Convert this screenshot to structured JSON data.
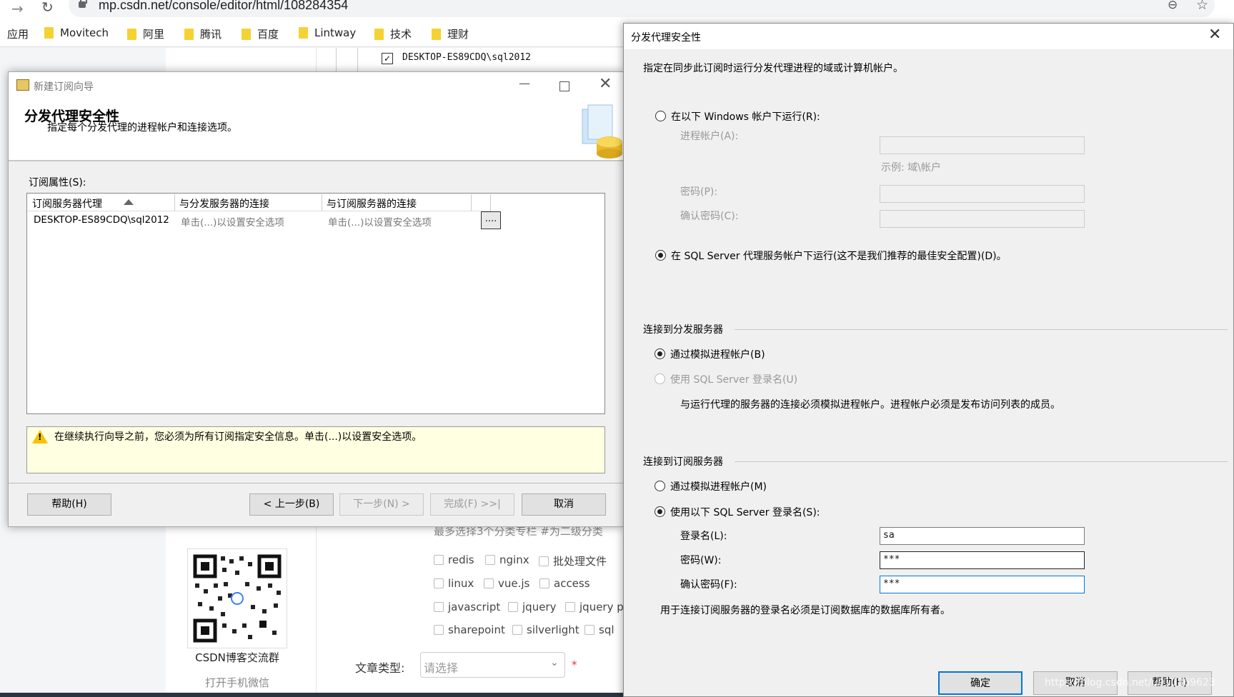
{
  "browser": {
    "url": "mp.csdn.net/console/editor/html/108284354",
    "bookmarks": [
      "应用",
      "Movitech",
      "阿里",
      "腾讯",
      "百度",
      "Lintway",
      "技术",
      "理财"
    ]
  },
  "background_page": {
    "top_row_item": "DESKTOP-ES89CDQ\\sql2012",
    "qr_caption": "CSDN博客交流群",
    "qr_subcaption": "打开手机微信",
    "tags_hint": "最多选择3个分类专栏  #为二级分类",
    "tags": [
      "redis",
      "nginx",
      "批处理文件",
      "linux",
      "vue.js",
      "access",
      "javascript",
      "jquery",
      "jquery pl",
      "sharepoint",
      "silverlight",
      "sql"
    ],
    "article_type_label": "文章类型:",
    "article_type_placeholder": "请选择",
    "required_mark": "*"
  },
  "wizard": {
    "title": "新建订阅向导",
    "heading": "分发代理安全性",
    "subheading": "指定每个分发代理的进程帐户和连接选项。",
    "props_label": "订阅属性(S):",
    "columns": [
      "订阅服务器代理",
      "与分发服务器的连接",
      "与订阅服务器的连接"
    ],
    "row": [
      "DESKTOP-ES89CDQ\\sql2012",
      "单击(...)以设置安全选项",
      "单击(...)以设置安全选项"
    ],
    "ellipsis": "....",
    "warning": "在继续执行向导之前，您必须为所有订阅指定安全信息。单击(...)以设置安全选项。",
    "buttons": {
      "help": "帮助(H)",
      "back": "< 上一步(B)",
      "next": "下一步(N) >",
      "finish": "完成(F) >>|",
      "cancel": "取消"
    }
  },
  "dialog": {
    "title": "分发代理安全性",
    "intro": "指定在同步此订阅时运行分发代理进程的域或计算机帐户。",
    "run_as_windows": "在以下 Windows 帐户下运行(R):",
    "process_account": "进程帐户(A):",
    "example": "示例: 域\\帐户",
    "password": "密码(P):",
    "confirm_password": "确认密码(C):",
    "run_as_agent": "在 SQL Server 代理服务帐户下运行(这不是我们推荐的最佳安全配置)(D)。",
    "distributor_group": "连接到分发服务器",
    "dist_impersonate": "通过模拟进程帐户(B)",
    "dist_sql_login": "使用 SQL Server 登录名(U)",
    "dist_note": "与运行代理的服务器的连接必须模拟进程帐户。进程帐户必须是发布访问列表的成员。",
    "subscriber_group": "连接到订阅服务器",
    "sub_impersonate": "通过模拟进程帐户(M)",
    "sub_sql_login": "使用以下 SQL Server 登录名(S):",
    "login_label": "登录名(L):",
    "login_value": "sa",
    "sub_password_label": "密码(W):",
    "sub_password_value": "***",
    "sub_confirm_label": "确认密码(F):",
    "sub_confirm_value": "***",
    "sub_note": "用于连接订阅服务器的登录名必须是订阅数据库的数据库所有者。",
    "buttons": {
      "ok": "确定",
      "cancel": "取消",
      "help": "帮助(H)"
    },
    "watermark": "https://blog.csdn.net/u010869623"
  }
}
